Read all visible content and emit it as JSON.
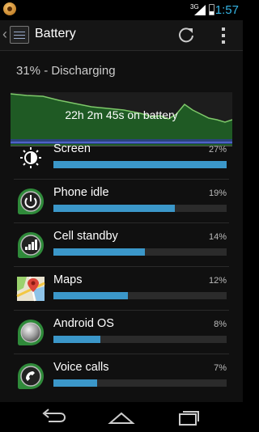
{
  "status_bar": {
    "network": "3G",
    "time": "1:57"
  },
  "action_bar": {
    "title": "Battery"
  },
  "battery": {
    "status": "31% - Discharging",
    "graph_label": "22h 2m 45s on battery"
  },
  "usage": [
    {
      "name": "Screen",
      "percent": "27%",
      "fraction": 1.0,
      "icon": "brightness-icon"
    },
    {
      "name": "Phone idle",
      "percent": "19%",
      "fraction": 0.7,
      "icon": "power-icon"
    },
    {
      "name": "Cell standby",
      "percent": "14%",
      "fraction": 0.53,
      "icon": "signal-icon"
    },
    {
      "name": "Maps",
      "percent": "12%",
      "fraction": 0.43,
      "icon": "maps-icon"
    },
    {
      "name": "Android OS",
      "percent": "8%",
      "fraction": 0.27,
      "icon": "android-os-icon"
    },
    {
      "name": "Voice calls",
      "percent": "7%",
      "fraction": 0.25,
      "icon": "phone-icon"
    }
  ],
  "colors": {
    "accent": "#35b5e5",
    "bar": "#3b97c9",
    "graph_line": "#7ec96a"
  }
}
